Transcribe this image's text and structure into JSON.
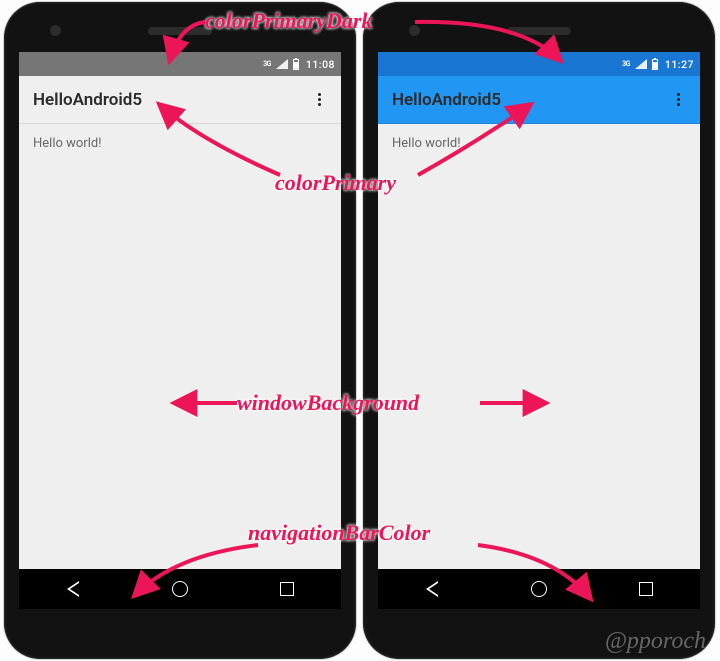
{
  "labels": {
    "colorPrimaryDark": "colorPrimaryDark",
    "colorPrimary": "colorPrimary",
    "windowBackground": "windowBackground",
    "navigationBarColor": "navigationBarColor"
  },
  "leftPhone": {
    "status": {
      "network": "3G",
      "time": "11:08"
    },
    "app": {
      "title": "HelloAndroid5"
    },
    "body": {
      "text": "Hello world!"
    },
    "colors": {
      "statusbar": "#767676",
      "appbar": "#efefef",
      "background": "#efefef",
      "navbar": "#000000"
    }
  },
  "rightPhone": {
    "status": {
      "network": "3G",
      "time": "11:27"
    },
    "app": {
      "title": "HelloAndroid5"
    },
    "body": {
      "text": "Hello world!"
    },
    "colors": {
      "statusbar": "#1976d2",
      "appbar": "#2196f3",
      "background": "#efefef",
      "navbar": "#000000"
    }
  },
  "watermark": "@pporoch"
}
